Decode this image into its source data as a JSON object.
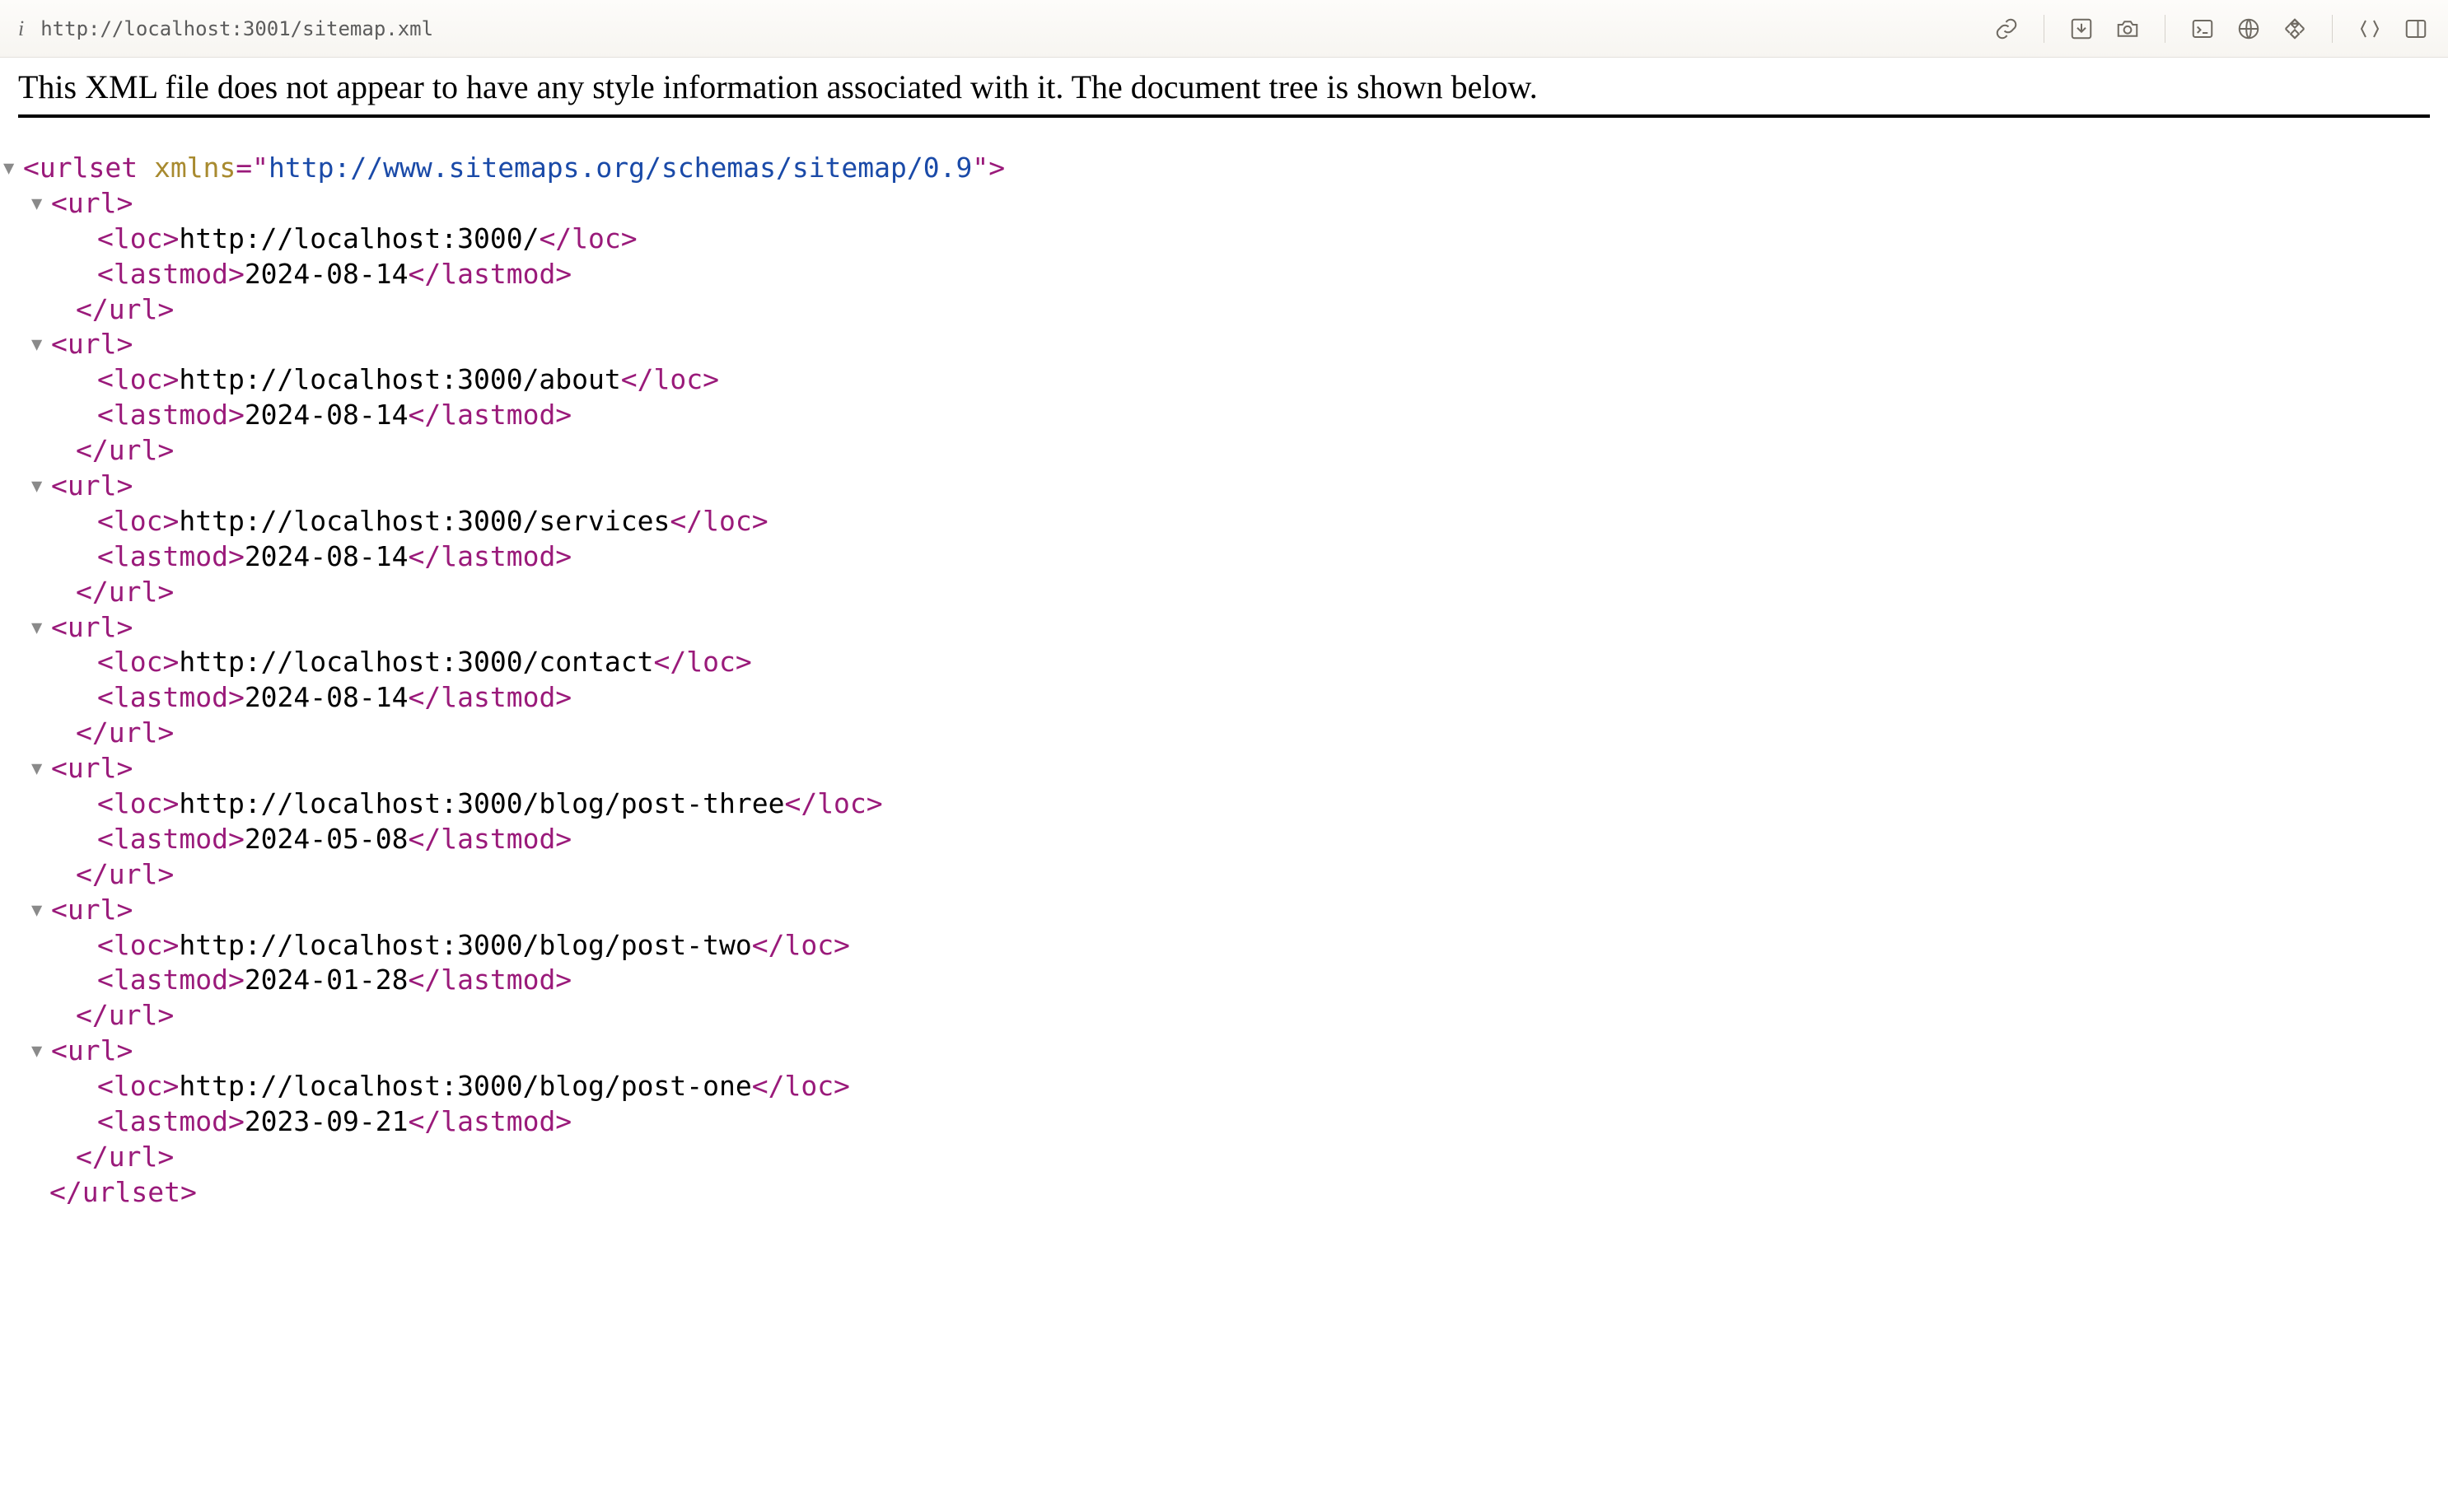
{
  "toolbar": {
    "url": "http://localhost:3001/sitemap.xml"
  },
  "message": "This XML file does not appear to have any style information associated with it. The document tree is shown below.",
  "xml": {
    "rootTag": "urlset",
    "xmlnsAttrName": "xmlns",
    "xmlnsAttrValue": "http://www.sitemaps.org/schemas/sitemap/0.9",
    "urlTag": "url",
    "locTag": "loc",
    "lastmodTag": "lastmod",
    "urls": [
      {
        "loc": "http://localhost:3000/",
        "lastmod": "2024-08-14"
      },
      {
        "loc": "http://localhost:3000/about",
        "lastmod": "2024-08-14"
      },
      {
        "loc": "http://localhost:3000/services",
        "lastmod": "2024-08-14"
      },
      {
        "loc": "http://localhost:3000/contact",
        "lastmod": "2024-08-14"
      },
      {
        "loc": "http://localhost:3000/blog/post-three",
        "lastmod": "2024-05-08"
      },
      {
        "loc": "http://localhost:3000/blog/post-two",
        "lastmod": "2024-01-28"
      },
      {
        "loc": "http://localhost:3000/blog/post-one",
        "lastmod": "2023-09-21"
      }
    ]
  }
}
